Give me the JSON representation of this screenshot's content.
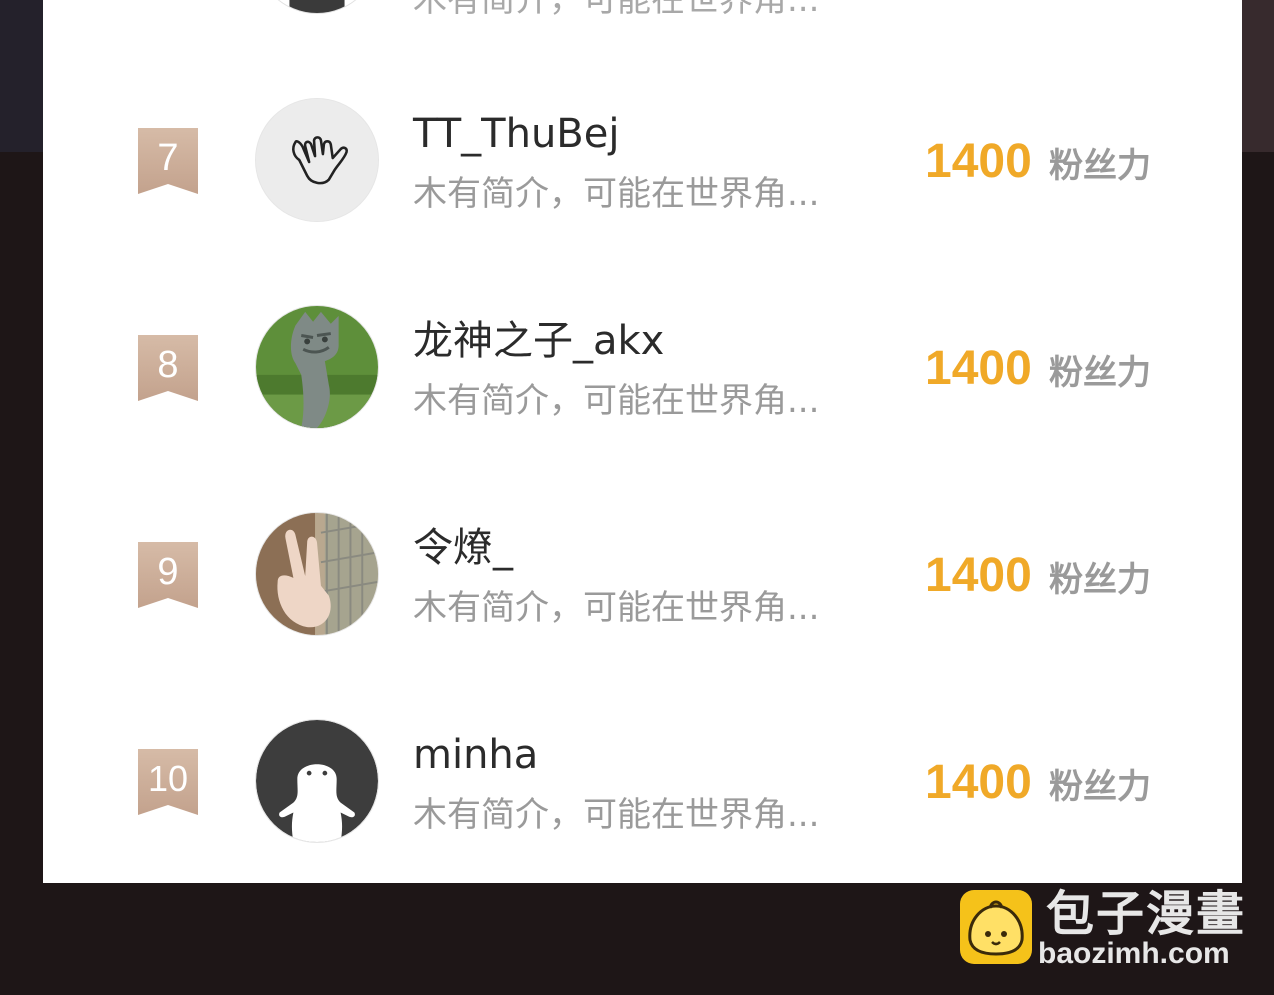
{
  "partial_row": {
    "bio": "木有简介，可能在世界角..."
  },
  "ranking": [
    {
      "rank": "7",
      "name": "TT_ThuBej",
      "bio": "木有简介，可能在世界角...",
      "fans_value": "1400",
      "fans_label": "粉丝力",
      "avatar_icon": "hang-loose-hand-icon"
    },
    {
      "rank": "8",
      "name": "龙神之子_akx",
      "bio": "木有简介，可能在世界角...",
      "fans_value": "1400",
      "fans_label": "粉丝力",
      "avatar_icon": "dragon-statue-photo"
    },
    {
      "rank": "9",
      "name": "令燎_",
      "bio": "木有简介，可能在世界角...",
      "fans_value": "1400",
      "fans_label": "粉丝力",
      "avatar_icon": "peace-sign-hand-photo"
    },
    {
      "rank": "10",
      "name": "minha",
      "bio": "木有简介，可能在世界角...",
      "fans_value": "1400",
      "fans_label": "粉丝力",
      "avatar_icon": "white-blob-character-icon"
    }
  ],
  "watermark": {
    "title": "包子漫畫",
    "domain": "baozimh.com"
  },
  "colors": {
    "accent": "#f0a928",
    "badge": "#c9ab97",
    "muted_text": "#9a9a9a",
    "background": "#1e1617"
  }
}
